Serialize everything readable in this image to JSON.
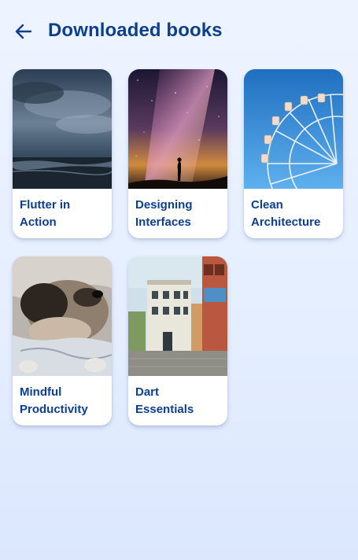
{
  "header": {
    "title": "Downloaded books",
    "back_icon": "arrow-left-icon"
  },
  "colors": {
    "primary": "#0d3f8f",
    "background": "#eaf1ff",
    "card": "#ffffff"
  },
  "books": [
    {
      "title": "Flutter in\nAction",
      "cover": "stormy-sea"
    },
    {
      "title": "Designing\nInterfaces",
      "cover": "milky-way-silhouette"
    },
    {
      "title": "Clean\nArchitecture",
      "cover": "ferris-wheel"
    },
    {
      "title": "Mindful\nProductivity",
      "cover": "bulldog-in-blanket"
    },
    {
      "title": "Dart\nEssentials",
      "cover": "town-street"
    }
  ]
}
